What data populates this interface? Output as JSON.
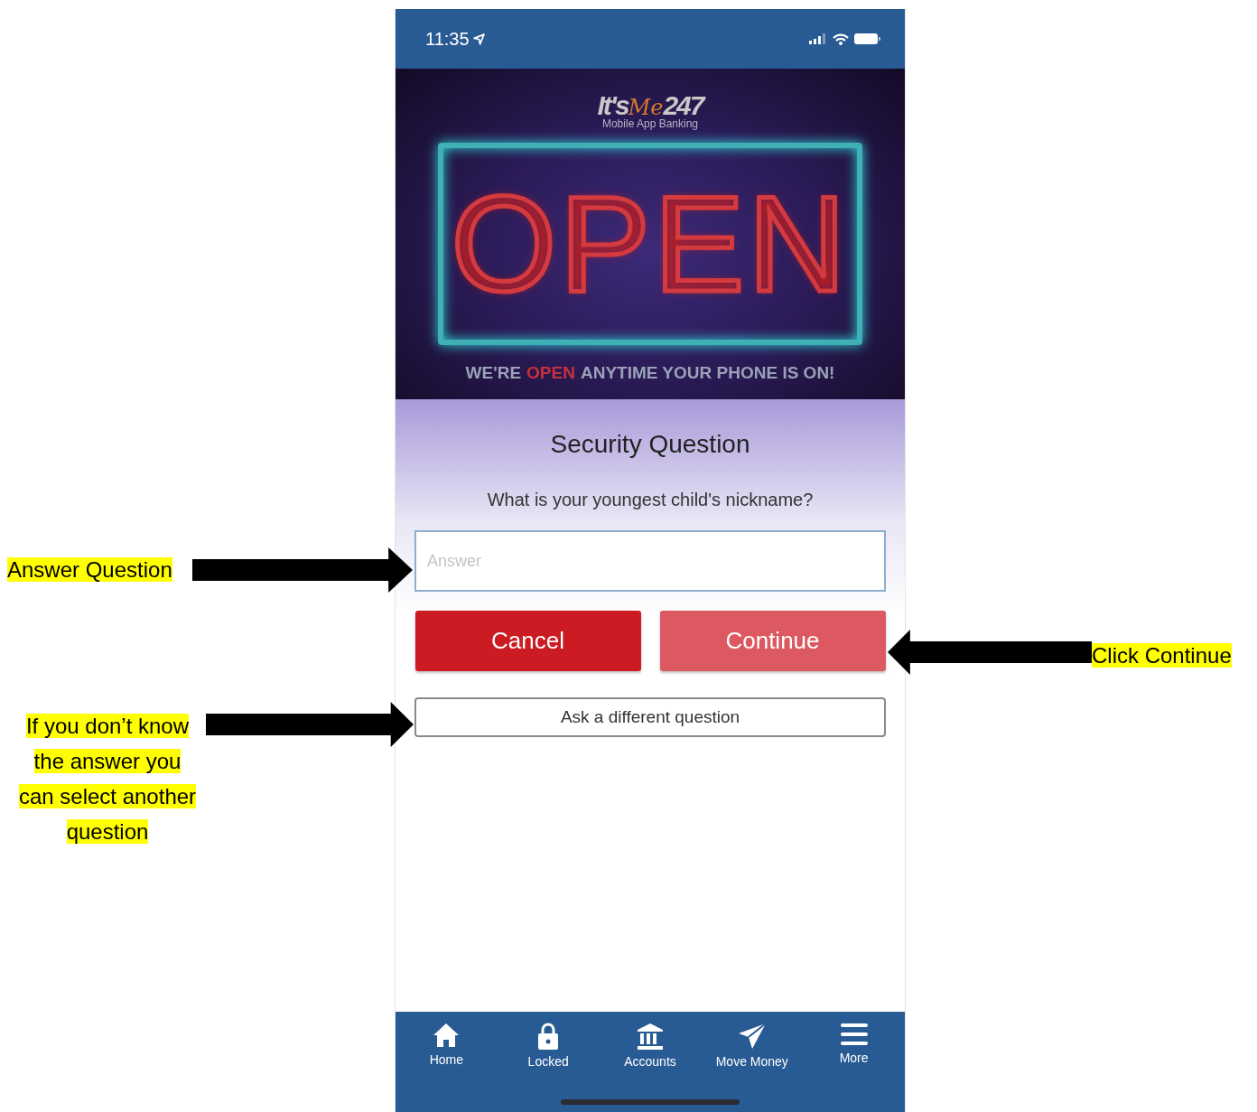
{
  "status_bar": {
    "time": "11:35"
  },
  "banner": {
    "logo": {
      "main": "It's",
      "accent": "Me",
      "number": "247",
      "subtitle": "Mobile App Banking"
    },
    "sign": "OPEN",
    "tagline": [
      {
        "text": "WE'RE",
        "highlight": false
      },
      {
        "text": "OPEN",
        "highlight": true
      },
      {
        "text": "ANYTIME YOUR PHONE IS ON!",
        "highlight": false
      }
    ]
  },
  "title": "Security Question",
  "question": "What is your youngest child's nickname?",
  "answer_field": {
    "placeholder": "Answer"
  },
  "buttons": [
    {
      "label": "Cancel",
      "disabled": false
    },
    {
      "label": "Continue",
      "disabled": true
    }
  ],
  "alternate_button": {
    "label": "Ask a different question"
  },
  "tab_bar": [
    {
      "label": "Home",
      "kind": "home"
    },
    {
      "label": "Locked",
      "kind": "lock"
    },
    {
      "label": "Accounts",
      "kind": "bank"
    },
    {
      "label": "Move Money",
      "kind": "send"
    },
    {
      "label": "More",
      "kind": "menu"
    }
  ],
  "annotations": [
    {
      "lines": [
        "Answer Question"
      ]
    },
    {
      "lines": [
        "Click Continue"
      ]
    },
    {
      "lines": [
        "If you don’t know",
        "the answer you",
        "can select another",
        "question"
      ]
    }
  ]
}
